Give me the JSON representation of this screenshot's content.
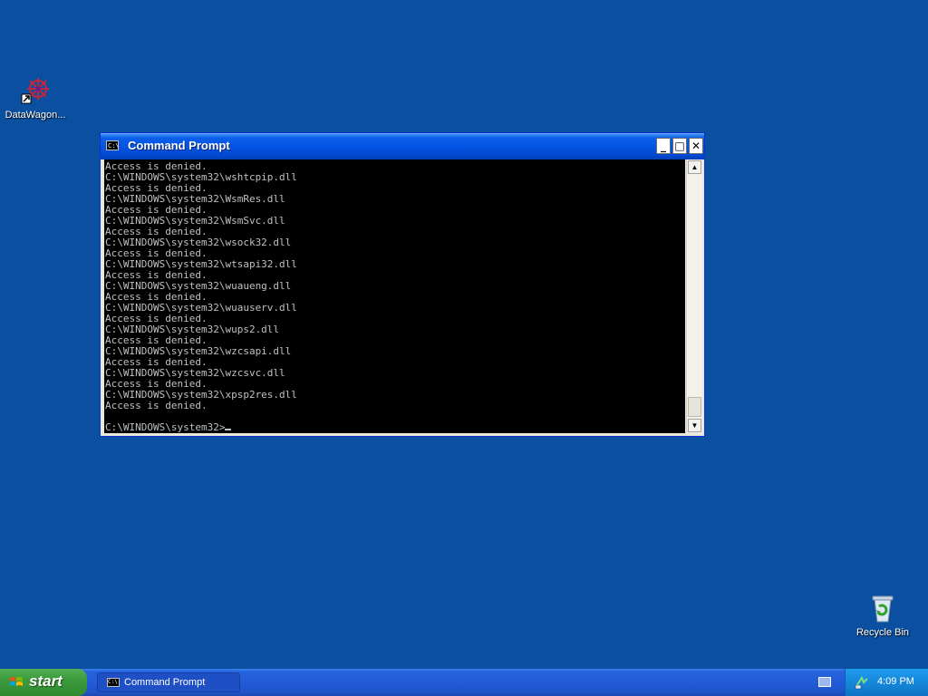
{
  "desktop": {
    "icons": [
      {
        "label": "DataWagon..."
      },
      {
        "label": "Recycle Bin"
      }
    ]
  },
  "window": {
    "title": "Command Prompt",
    "app_icon_text": "C:\\",
    "controls": {
      "minimize": "_",
      "maximize": "□",
      "close": "✕"
    },
    "console_lines": [
      "Access is denied.",
      "C:\\WINDOWS\\system32\\wshtcpip.dll",
      "Access is denied.",
      "C:\\WINDOWS\\system32\\WsmRes.dll",
      "Access is denied.",
      "C:\\WINDOWS\\system32\\WsmSvc.dll",
      "Access is denied.",
      "C:\\WINDOWS\\system32\\wsock32.dll",
      "Access is denied.",
      "C:\\WINDOWS\\system32\\wtsapi32.dll",
      "Access is denied.",
      "C:\\WINDOWS\\system32\\wuaueng.dll",
      "Access is denied.",
      "C:\\WINDOWS\\system32\\wuauserv.dll",
      "Access is denied.",
      "C:\\WINDOWS\\system32\\wups2.dll",
      "Access is denied.",
      "C:\\WINDOWS\\system32\\wzcsapi.dll",
      "Access is denied.",
      "C:\\WINDOWS\\system32\\wzcsvc.dll",
      "Access is denied.",
      "C:\\WINDOWS\\system32\\xpsp2res.dll",
      "Access is denied.",
      ""
    ],
    "prompt": "C:\\WINDOWS\\system32>",
    "scrollbar": {
      "up_arrow": "▲",
      "down_arrow": "▼",
      "position_fraction": 0.95
    }
  },
  "taskbar": {
    "start_label": "start",
    "tasks": [
      {
        "label": "Command Prompt",
        "icon": "cmd-icon"
      }
    ],
    "tray": {
      "clock": "4:09 PM",
      "icons": [
        "keyboard-icon",
        "network-icon"
      ]
    }
  },
  "colors": {
    "desktop_bg": "#0a4fa0",
    "titlebar": "#0554e3",
    "console_bg": "#000000",
    "console_text": "#c0c0c0",
    "start_button": "#3c9a3c",
    "tray_bg": "#1687da"
  }
}
